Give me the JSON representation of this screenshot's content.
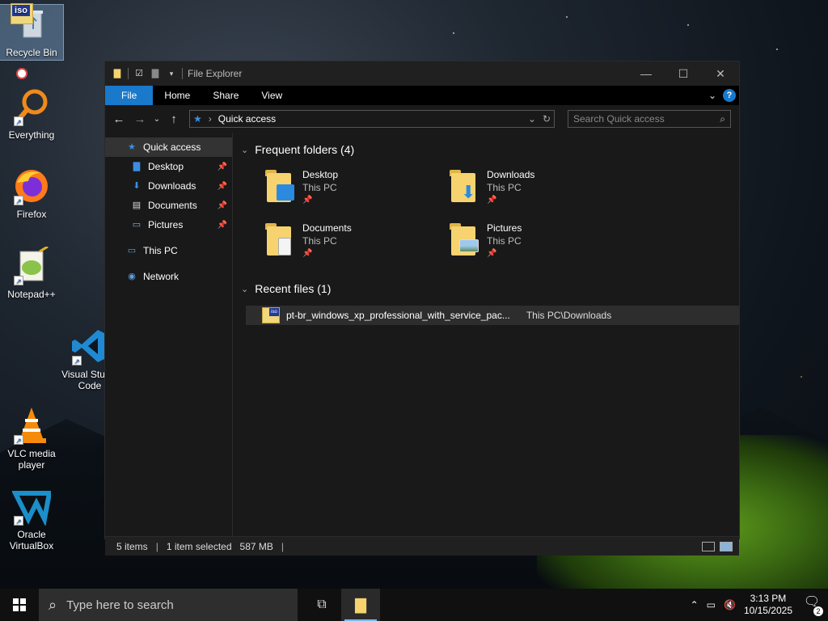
{
  "desktop": {
    "icons": [
      {
        "label": "Recycle Bin",
        "icon": "recycle-bin-icon"
      },
      {
        "label": "Everything",
        "icon": "everything-search-icon"
      },
      {
        "label": "Firefox",
        "icon": "firefox-icon"
      },
      {
        "label": "Notepad++",
        "icon": "notepad-plus-plus-icon"
      },
      {
        "label": "Visual Studio Code",
        "icon": "vscode-icon"
      },
      {
        "label": "VLC media player",
        "icon": "vlc-icon"
      },
      {
        "label": "Oracle VirtualBox",
        "icon": "virtualbox-icon"
      }
    ],
    "iso_badge": "iso"
  },
  "window": {
    "title": "File Explorer",
    "ribbon_tabs": [
      "File",
      "Home",
      "Share",
      "View"
    ],
    "address": "Quick access",
    "search_placeholder": "Search Quick access"
  },
  "navpane": {
    "quick_access": "Quick access",
    "pinned": [
      "Desktop",
      "Downloads",
      "Documents",
      "Pictures"
    ],
    "this_pc": "This PC",
    "network": "Network"
  },
  "content": {
    "frequent_header": "Frequent folders (4)",
    "folders": [
      {
        "name": "Desktop",
        "location": "This PC"
      },
      {
        "name": "Downloads",
        "location": "This PC"
      },
      {
        "name": "Documents",
        "location": "This PC"
      },
      {
        "name": "Pictures",
        "location": "This PC"
      }
    ],
    "recent_header": "Recent files (1)",
    "recent_files": [
      {
        "name": "pt-br_windows_xp_professional_with_service_pac...",
        "path": "This PC\\Downloads"
      }
    ]
  },
  "status": {
    "items": "5 items",
    "selected": "1 item selected",
    "size": "587 MB"
  },
  "taskbar": {
    "search_placeholder": "Type here to search",
    "time": "3:13 PM",
    "date": "10/15/2025",
    "notification_count": "2"
  },
  "colors": {
    "accent": "#1979ca",
    "folder": "#f6d36e"
  }
}
